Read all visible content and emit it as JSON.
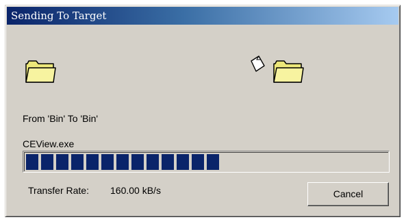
{
  "window": {
    "title": "Sending To Target"
  },
  "transfer": {
    "from_to": "From 'Bin' To 'Bin'",
    "filename": "CEView.exe",
    "progress_fraction": 0.54,
    "rate_label": "Transfer Rate:",
    "rate_value": "160.00 kB/s"
  },
  "buttons": {
    "cancel_label": "Cancel"
  },
  "icons": {
    "source": "folder-icon",
    "target": "folder-icon",
    "animation": "flying-document-icon"
  },
  "colors": {
    "title_start": "#0a246a",
    "title_end": "#a6caf0",
    "progress_fill": "#0a246a",
    "folder": "#ece77a"
  }
}
